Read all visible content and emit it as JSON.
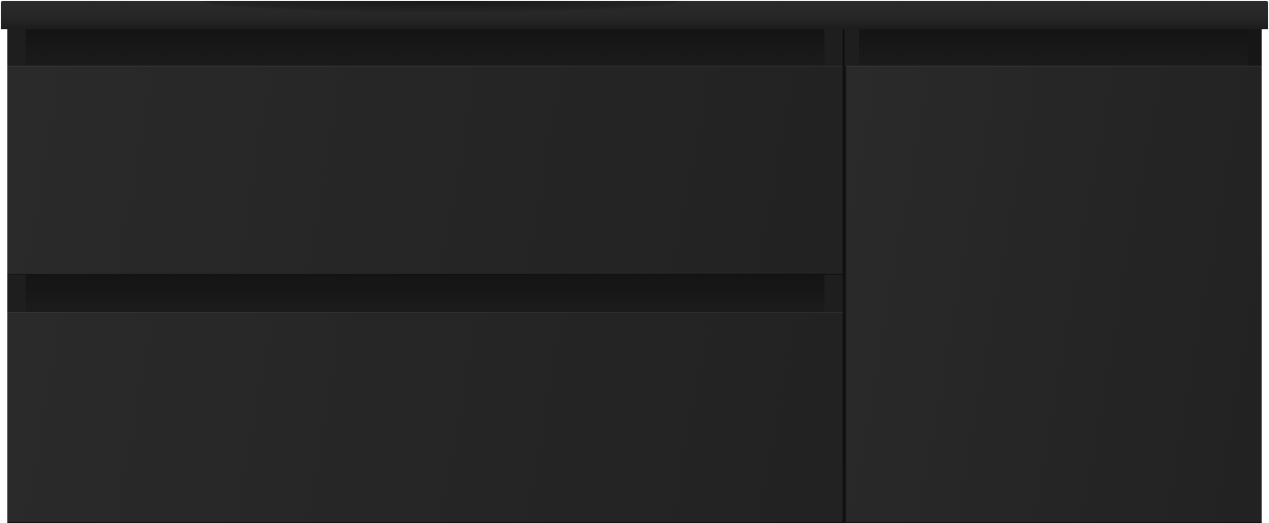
{
  "scene": {
    "subject": "vanity-cabinet",
    "colors": {
      "countertop": "#262626",
      "cabinet_body": "#161616",
      "drawer_front": "#262626",
      "background": "#ffffff"
    }
  }
}
